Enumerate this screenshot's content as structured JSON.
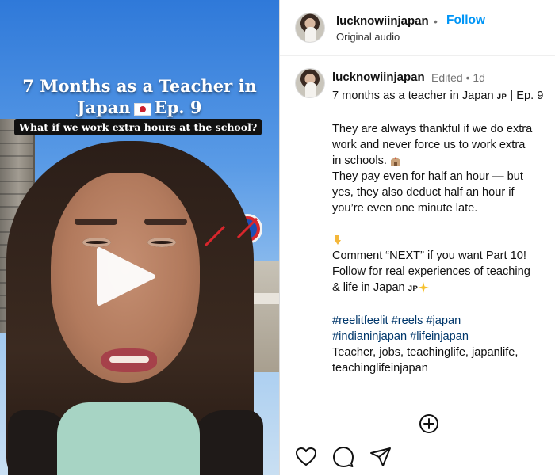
{
  "video": {
    "title_line1": "7 Months as a Teacher in",
    "title_line2_prefix": "Japan",
    "title_line2_suffix": "Ep. 9",
    "subtitle": "What if we work extra hours at the school?"
  },
  "header": {
    "username": "lucknowiinjapan",
    "separator": "•",
    "follow_label": "Follow",
    "audio": "Original audio"
  },
  "caption": {
    "username": "lucknowiinjapan",
    "meta": "Edited • 1d",
    "line1_text": "7 months as a teacher in Japan",
    "line1_tag": "JP",
    "line1_tail": "| Ep. 9",
    "p1": [
      "They are always thankful if we do extra",
      "work and never force us to work extra",
      "in schools."
    ],
    "p2": [
      "They pay even for half an hour — but",
      "yes, they also deduct half an hour if",
      "you’re even one minute late."
    ],
    "p3_line1": "Comment “NEXT” if you want Part 10!",
    "p3_line2": "Follow for real experiences of teaching",
    "p3_line3_text": "& life in Japan",
    "p3_line3_tag": "JP",
    "hashtags_line1": "#reelitfeelit #reels #japan",
    "hashtags_line2": "#indianinjapan #lifeinjapan",
    "keywords_line1": "Teacher, jobs, teachinglife, japanlife,",
    "keywords_line2": "teachinglifeinjapan"
  },
  "icons": {
    "play": "play-icon",
    "add_comment": "add-circle-icon",
    "like": "heart-icon",
    "comment": "comment-icon",
    "share": "send-icon"
  }
}
